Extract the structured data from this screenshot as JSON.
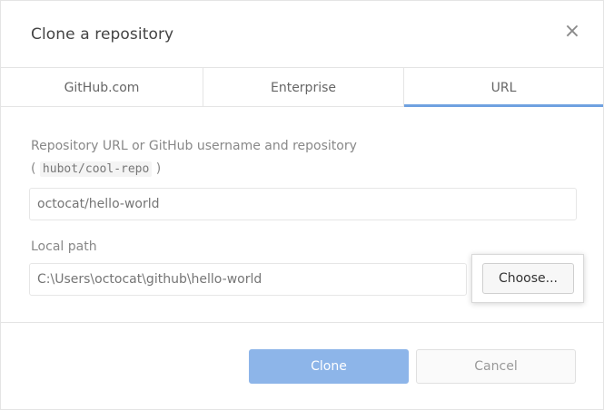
{
  "dialog": {
    "title": "Clone a repository",
    "close_glyph": "×"
  },
  "tabs": [
    {
      "label": "GitHub.com",
      "active": false
    },
    {
      "label": "Enterprise",
      "active": false
    },
    {
      "label": "URL",
      "active": true
    }
  ],
  "url_field": {
    "label": "Repository URL or GitHub username and repository",
    "hint_open": "(",
    "hint_code": "hubot/cool-repo",
    "hint_close": ")",
    "placeholder": "octocat/hello-world"
  },
  "path_field": {
    "label": "Local path",
    "placeholder": "C:\\Users\\octocat\\github\\hello-world",
    "choose_label": "Choose..."
  },
  "actions": {
    "clone_label": "Clone",
    "cancel_label": "Cancel"
  },
  "colors": {
    "accent": "#6fa1e0",
    "primary_button": "#8db5e9"
  },
  "icons": {
    "close": "close-icon"
  }
}
